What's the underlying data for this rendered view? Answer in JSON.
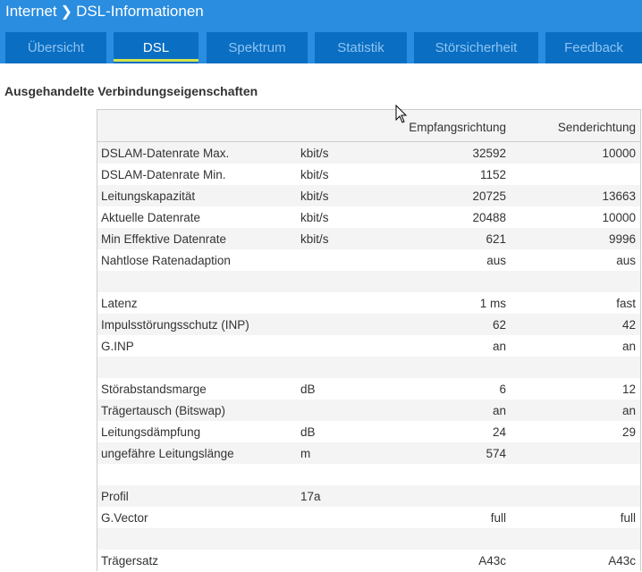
{
  "header": {
    "breadcrumb": [
      "Internet",
      "DSL-Informationen"
    ]
  },
  "tabs": [
    {
      "label": "Übersicht",
      "active": false
    },
    {
      "label": "DSL",
      "active": true
    },
    {
      "label": "Spektrum",
      "active": false
    },
    {
      "label": "Statistik",
      "active": false
    },
    {
      "label": "Störsicherheit",
      "active": false
    },
    {
      "label": "Feedback",
      "active": false
    }
  ],
  "section_title": "Ausgehandelte Verbindungseigenschaften",
  "table": {
    "columns": [
      "",
      "",
      "Empfangsrichtung",
      "Senderichtung"
    ],
    "rows": [
      [
        "DSLAM-Datenrate Max.",
        "kbit/s",
        "32592",
        "10000"
      ],
      [
        "DSLAM-Datenrate Min.",
        "kbit/s",
        "1152",
        ""
      ],
      [
        "Leitungskapazität",
        "kbit/s",
        "20725",
        "13663"
      ],
      [
        "Aktuelle Datenrate",
        "kbit/s",
        "20488",
        "10000"
      ],
      [
        "Min Effektive Datenrate",
        "kbit/s",
        "621",
        "9996"
      ],
      [
        "Nahtlose Ratenadaption",
        "",
        "aus",
        "aus"
      ],
      [
        "",
        "",
        "",
        ""
      ],
      [
        "Latenz",
        "",
        "1 ms",
        "fast"
      ],
      [
        "Impulsstörungsschutz (INP)",
        "",
        "62",
        "42"
      ],
      [
        "G.INP",
        "",
        "an",
        "an"
      ],
      [
        "",
        "",
        "",
        ""
      ],
      [
        "Störabstandsmarge",
        "dB",
        "6",
        "12"
      ],
      [
        "Trägertausch (Bitswap)",
        "",
        "an",
        "an"
      ],
      [
        "Leitungsdämpfung",
        "dB",
        "24",
        "29"
      ],
      [
        "ungefähre Leitungslänge",
        "m",
        "574",
        ""
      ],
      [
        "",
        "",
        "",
        ""
      ],
      [
        "Profil",
        "17a",
        "",
        ""
      ],
      [
        "G.Vector",
        "",
        "full",
        "full"
      ],
      [
        "",
        "",
        "",
        ""
      ],
      [
        "Trägersatz",
        "",
        "A43c",
        "A43c"
      ]
    ]
  }
}
